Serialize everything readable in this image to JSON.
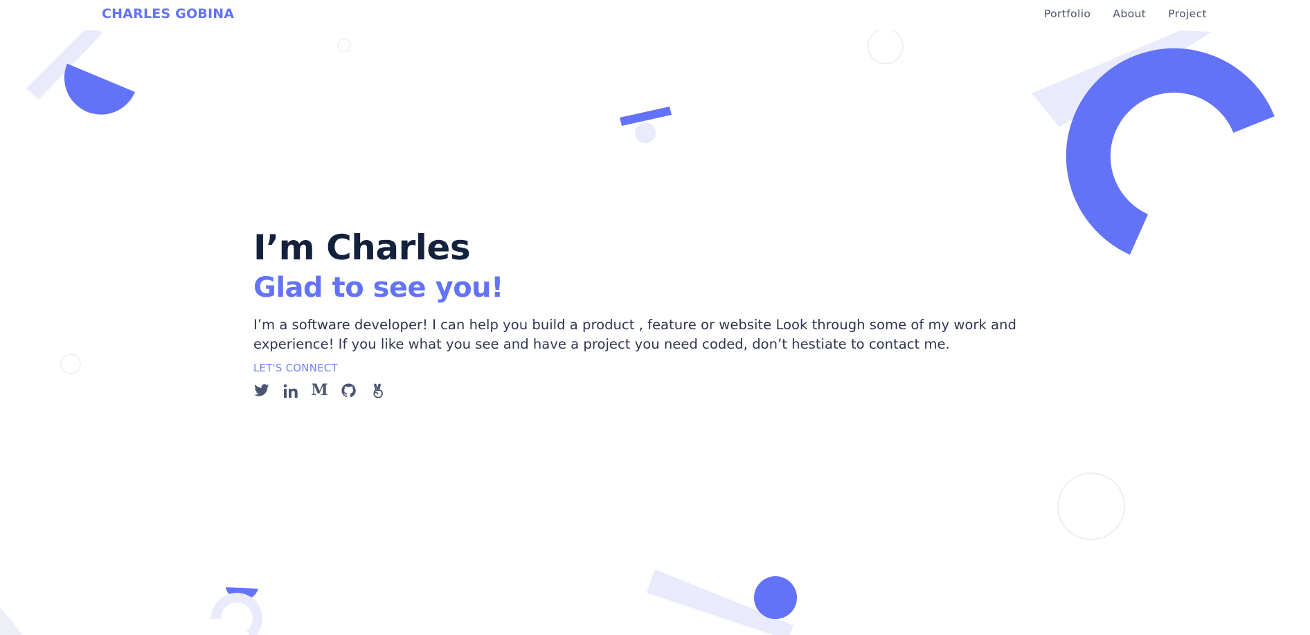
{
  "colors": {
    "accent": "#6373f7",
    "accent_light": "#e9eafc",
    "heading": "#14213d",
    "text": "#2f3550",
    "icon": "#4b5570",
    "ring": "#eeeef2"
  },
  "header": {
    "brand": "CHARLES GOBINA",
    "nav": [
      {
        "label": "Portfolio"
      },
      {
        "label": "About"
      },
      {
        "label": "Project"
      }
    ]
  },
  "hero": {
    "title": "I’m Charles",
    "subtitle": "Glad to see you!",
    "description": "I’m a software developer! I can help you build a product , feature or website Look through some of my work and experience! If you like what you see and have a project you need coded, don’t hestiate to contact me.",
    "connect_label": "LET'S CONNECT"
  },
  "socials": [
    {
      "name": "twitter",
      "icon": "twitter-icon"
    },
    {
      "name": "linkedin",
      "icon": "linkedin-icon"
    },
    {
      "name": "medium",
      "icon": "medium-icon"
    },
    {
      "name": "github",
      "icon": "github-icon"
    },
    {
      "name": "angellist",
      "icon": "angellist-icon"
    }
  ]
}
